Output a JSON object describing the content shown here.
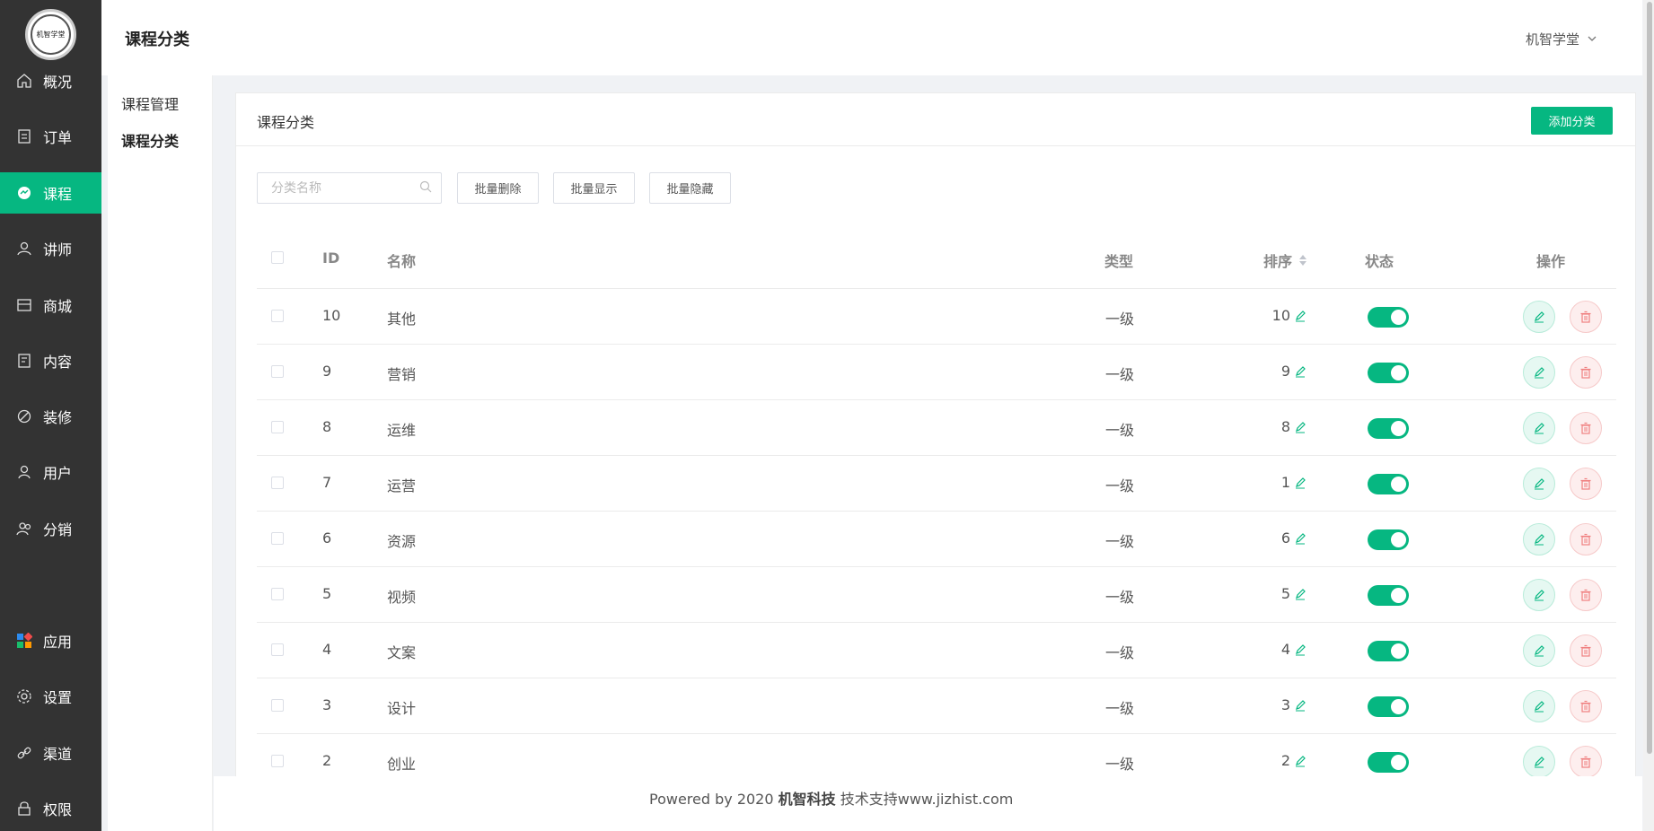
{
  "sidebar": {
    "logo_text": "机智学堂",
    "items": [
      {
        "label": "概况",
        "icon": "home-icon",
        "active": false
      },
      {
        "label": "订单",
        "icon": "order-icon",
        "active": false
      },
      {
        "label": "课程",
        "icon": "course-icon",
        "active": true
      },
      {
        "label": "讲师",
        "icon": "teacher-icon",
        "active": false
      },
      {
        "label": "商城",
        "icon": "store-icon",
        "active": false
      },
      {
        "label": "内容",
        "icon": "content-icon",
        "active": false
      },
      {
        "label": "装修",
        "icon": "decorate-icon",
        "active": false
      },
      {
        "label": "用户",
        "icon": "user-icon",
        "active": false
      },
      {
        "label": "分销",
        "icon": "distribution-icon",
        "active": false
      },
      {
        "label": "应用",
        "icon": "apps-icon",
        "active": false
      },
      {
        "label": "设置",
        "icon": "settings-icon",
        "active": false
      },
      {
        "label": "渠道",
        "icon": "link-icon",
        "active": false
      },
      {
        "label": "权限",
        "icon": "lock-icon",
        "active": false
      }
    ]
  },
  "subnav": {
    "items": [
      {
        "label": "课程管理",
        "active": false
      },
      {
        "label": "课程分类",
        "active": true
      }
    ]
  },
  "header": {
    "title": "课程分类",
    "user": "机智学堂"
  },
  "card": {
    "title": "课程分类",
    "add_label": "添加分类"
  },
  "toolbar": {
    "search_placeholder": "分类名称",
    "batch_delete": "批量删除",
    "batch_show": "批量显示",
    "batch_hide": "批量隐藏"
  },
  "table": {
    "headers": {
      "id": "ID",
      "name": "名称",
      "type": "类型",
      "sort": "排序",
      "status": "状态",
      "ops": "操作"
    },
    "rows": [
      {
        "id": "10",
        "name": "其他",
        "type": "一级",
        "sort": "10",
        "status": true
      },
      {
        "id": "9",
        "name": "营销",
        "type": "一级",
        "sort": "9",
        "status": true
      },
      {
        "id": "8",
        "name": "运维",
        "type": "一级",
        "sort": "8",
        "status": true
      },
      {
        "id": "7",
        "name": "运营",
        "type": "一级",
        "sort": "1",
        "status": true
      },
      {
        "id": "6",
        "name": "资源",
        "type": "一级",
        "sort": "6",
        "status": true
      },
      {
        "id": "5",
        "name": "视频",
        "type": "一级",
        "sort": "5",
        "status": true
      },
      {
        "id": "4",
        "name": "文案",
        "type": "一级",
        "sort": "4",
        "status": true
      },
      {
        "id": "3",
        "name": "设计",
        "type": "一级",
        "sort": "3",
        "status": true
      },
      {
        "id": "2",
        "name": "创业",
        "type": "一级",
        "sort": "2",
        "status": true
      }
    ]
  },
  "footer": {
    "prefix": "Powered by 2020 ",
    "company": "机智科技",
    "suffix": " 技术支持www.jizhist.com"
  },
  "colors": {
    "accent": "#06b781",
    "sidebar_bg": "#333333",
    "danger": "#f08080"
  }
}
